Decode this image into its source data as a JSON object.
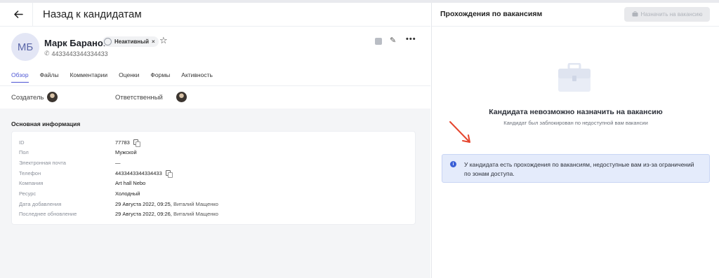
{
  "header": {
    "title": "Назад к кандидатам"
  },
  "candidate": {
    "initials": "МБ",
    "name": "Марк Баранов",
    "status": "Неактивный",
    "phone": "4433443344334433"
  },
  "tabs": [
    "Обзор",
    "Файлы",
    "Комментарии",
    "Оценки",
    "Формы",
    "Активность"
  ],
  "people": {
    "creator_label": "Создатель",
    "responsible_label": "Ответственный"
  },
  "info": {
    "section_title": "Основная информация",
    "rows": [
      {
        "label": "ID",
        "value": "77783",
        "copy": true
      },
      {
        "label": "Пол",
        "value": "Мужской"
      },
      {
        "label": "Электронная почта",
        "value": "—"
      },
      {
        "label": "Телефон",
        "value": "4433443344334433",
        "copy": true
      },
      {
        "label": "Компания",
        "value": "Art hall Nebo"
      },
      {
        "label": "Ресурс",
        "value": "Холодный"
      },
      {
        "label": "Дата добавления",
        "value": "29 Августа 2022, 09:25,",
        "author": "Виталий Мащенко"
      },
      {
        "label": "Последнее обновление",
        "value": "29 Августа 2022, 09:26,",
        "author": "Виталий Мащенко"
      }
    ]
  },
  "vacancies": {
    "title": "Прохождения по вакансиям",
    "assign_label": "Назначить на вакансию",
    "empty_title": "Кандидата невозможно назначить на вакансию",
    "empty_subtitle": "Кандидат был заблокирован по недоступной вам вакансии",
    "notice": "У кандидата есть прохождения по вакансиям, недоступные вам из-за ограничений по зонам доступа."
  },
  "colors": {
    "accent": "#4c55d4",
    "arrow": "#e5462f",
    "notice_bg": "#e4ebfb",
    "info_icon": "#3a5fd6"
  }
}
